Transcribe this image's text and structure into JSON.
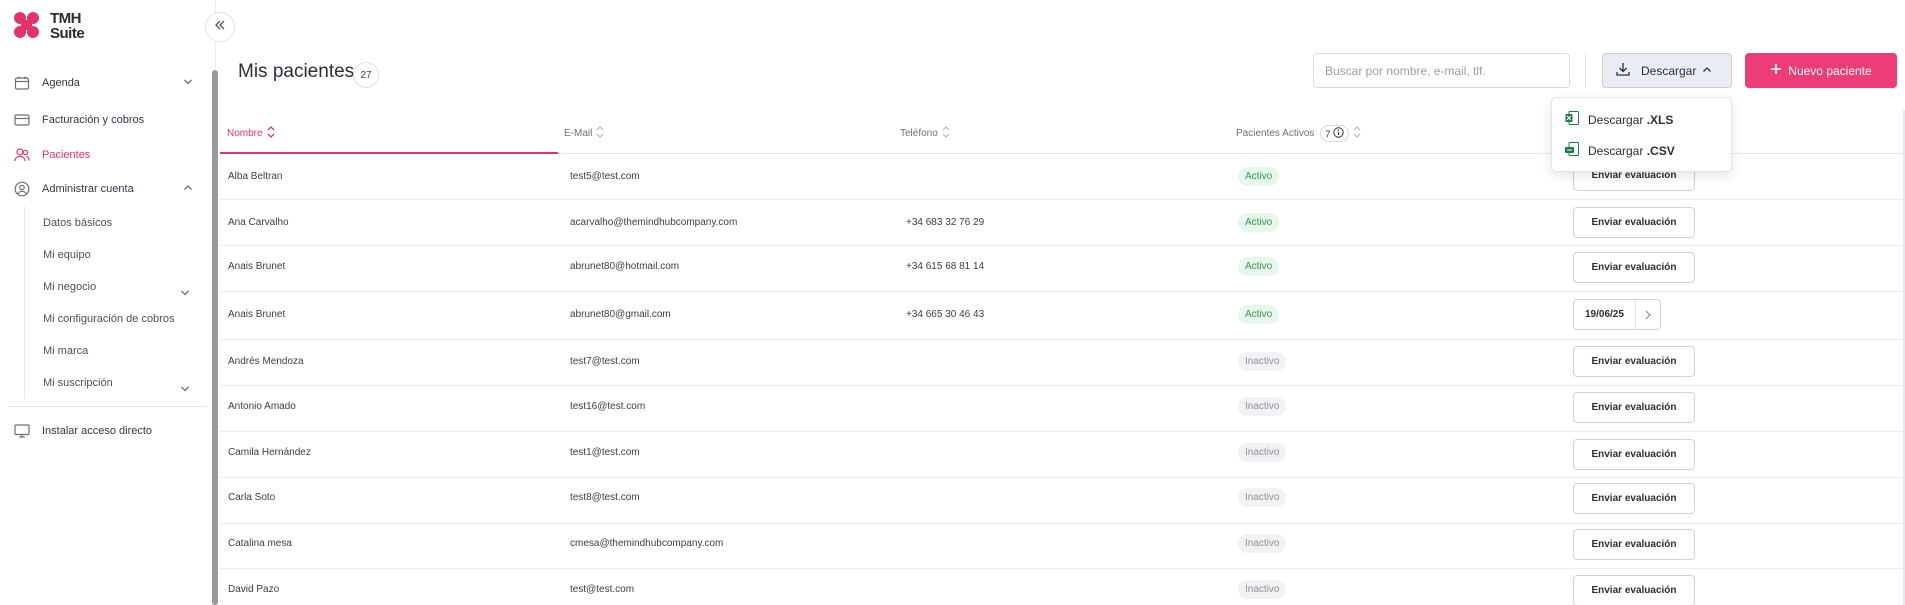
{
  "brand": {
    "line1": "TMH",
    "line2": "Suite",
    "color": "#e5336a"
  },
  "sidebar": {
    "items": [
      {
        "label": "Agenda",
        "icon": "calendar-icon"
      },
      {
        "label": "Facturación y cobros",
        "icon": "card-icon"
      },
      {
        "label": "Pacientes",
        "icon": "users-icon",
        "active": true
      },
      {
        "label": "Administrar cuenta",
        "icon": "user-circle-icon"
      }
    ],
    "sub_items": [
      "Datos básicos",
      "Mi equipo",
      "Mi negocio",
      "Mi configuración de cobros",
      "Mi marca",
      "Mi suscripción"
    ],
    "shortcut": "Instalar acceso directo"
  },
  "header": {
    "title": "Mis pacientes",
    "count": "27",
    "search_placeholder": "Buscar por nombre, e-mail, tlf.",
    "download_label": "Descargar",
    "new_label": "Nuevo paciente"
  },
  "download_menu": {
    "xls": {
      "prefix": "Descargar",
      "ext": ".XLS"
    },
    "csv": {
      "prefix": "Descargar",
      "ext": ".CSV"
    }
  },
  "table": {
    "columns": {
      "name": "Nombre",
      "email": "E-Mail",
      "phone": "Teléfono",
      "active": "Pacientes Activos",
      "active_count": "7"
    },
    "eval_label": "Enviar evaluación",
    "rows": [
      {
        "name": "Alba Beltran",
        "email": "test5@test.com",
        "phone": "",
        "status": "Activo"
      },
      {
        "name": "Ana Carvalho",
        "email": "acarvalho@themindhubcompany.com",
        "phone": "+34 683 32 76 29",
        "status": "Activo"
      },
      {
        "name": "Anais Brunet",
        "email": "abrunet80@hotmail.com",
        "phone": "+34 615 68 81 14",
        "status": "Activo"
      },
      {
        "name": "Anais Brunet",
        "email": "abrunet80@gmail.com",
        "phone": "+34 665 30 46 43",
        "status": "Activo",
        "date": "19/06/25"
      },
      {
        "name": "Andrés Mendoza",
        "email": "test7@test.com",
        "phone": "",
        "status": "Inactivo"
      },
      {
        "name": "Antonio Amado",
        "email": "test16@test.com",
        "phone": "",
        "status": "Inactivo"
      },
      {
        "name": "Camila Hernández",
        "email": "test1@test.com",
        "phone": "",
        "status": "Inactivo"
      },
      {
        "name": "Carla Soto",
        "email": "test8@test.com",
        "phone": "",
        "status": "Inactivo"
      },
      {
        "name": "Catalina mesa",
        "email": "cmesa@themindhubcompany.com",
        "phone": "",
        "status": "Inactivo"
      },
      {
        "name": "David Pazo",
        "email": "test@test.com",
        "phone": "",
        "status": "Inactivo"
      }
    ]
  }
}
